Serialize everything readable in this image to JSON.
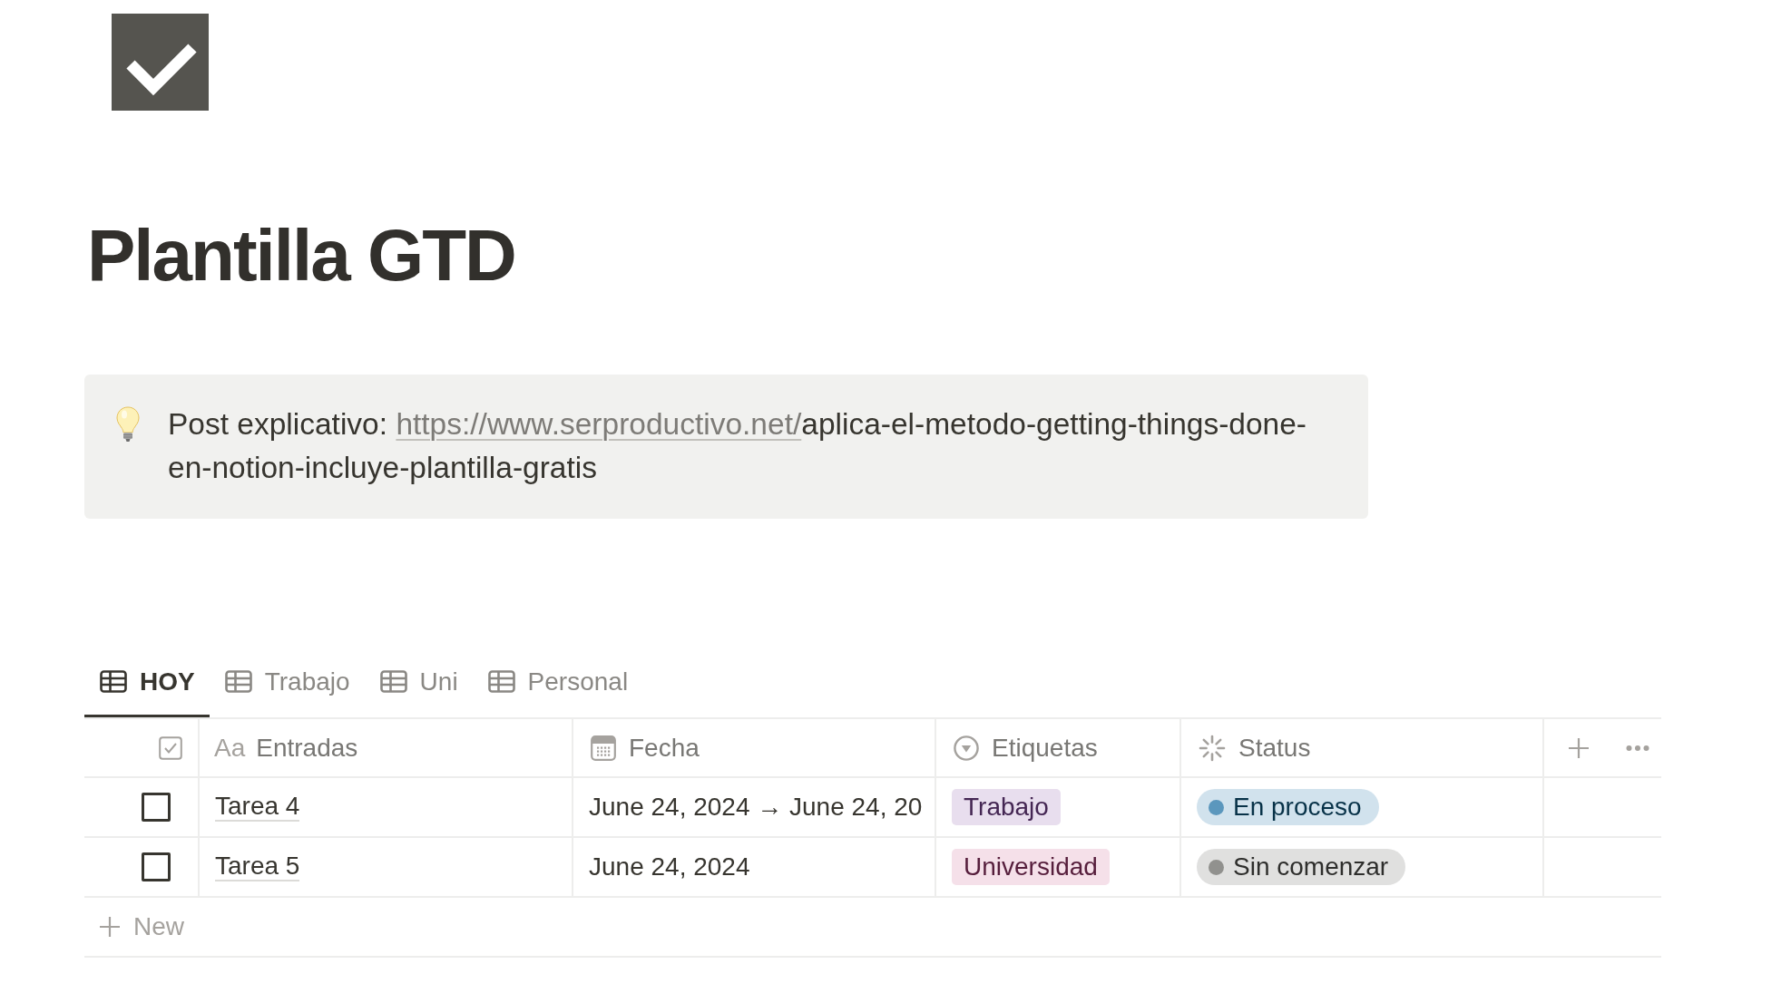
{
  "title": "Plantilla GTD",
  "callout": {
    "text": "Post explicativo: ",
    "link": "https://www.serproductivo.net/",
    "text_after": "aplica-el-metodo-getting-things-done-en-notion-incluye-plantilla-gratis"
  },
  "tabs": [
    {
      "label": "HOY",
      "selected": true
    },
    {
      "label": "Trabajo",
      "selected": false
    },
    {
      "label": "Uni",
      "selected": false
    },
    {
      "label": "Personal",
      "selected": false
    }
  ],
  "table": {
    "columns": [
      {
        "kind": "checkbox"
      },
      {
        "kind": "title",
        "icon_text": "Aa",
        "label": "Entradas"
      },
      {
        "kind": "date",
        "label": "Fecha"
      },
      {
        "kind": "select",
        "label": "Etiquetas"
      },
      {
        "kind": "status",
        "label": "Status"
      }
    ],
    "rows": [
      {
        "checked": false,
        "title": "Tarea 4",
        "date": "June 24, 2024 → June 24, 20",
        "tags": [
          {
            "label": "Trabajo",
            "color": "#e8deee"
          }
        ],
        "status": {
          "label": "En proceso",
          "color": "#5b97bd"
        }
      },
      {
        "checked": false,
        "title": "Tarea 5",
        "date": "June 24, 2024",
        "tags": [
          {
            "label": "Universidad",
            "color": "#f5e0e9"
          }
        ],
        "status": {
          "label": "Sin comenzar",
          "color": "#91918e"
        }
      }
    ],
    "new_row": {
      "label": "New"
    }
  }
}
